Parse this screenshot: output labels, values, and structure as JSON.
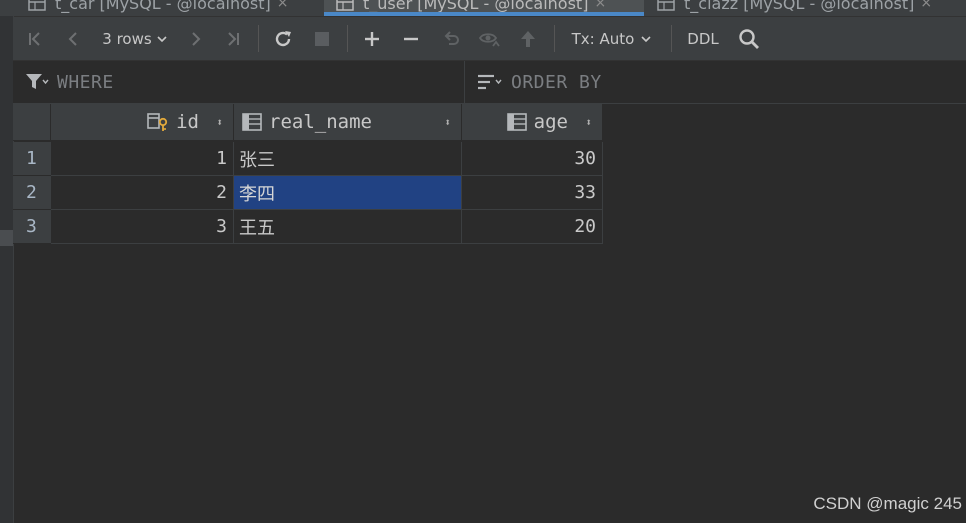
{
  "tabs": [
    {
      "label": "t_car [MySQL - @localhost]",
      "close": "×"
    },
    {
      "label": "t_user [MySQL - @localhost]",
      "close": "×"
    },
    {
      "label": "t_clazz [MySQL - @localhost]",
      "close": "×"
    }
  ],
  "toolbar": {
    "rows_label": "3 rows",
    "tx_label": "Tx: Auto",
    "ddl_label": "DDL"
  },
  "filter": {
    "where_label": "WHERE",
    "order_label": "ORDER BY"
  },
  "grid": {
    "columns": [
      {
        "name": "id",
        "sort": "⬍"
      },
      {
        "name": "real_name",
        "sort": "⬍"
      },
      {
        "name": "age",
        "sort": "⬍"
      }
    ],
    "rows": [
      {
        "num": "1",
        "id": "1",
        "real_name": "张三",
        "age": "30"
      },
      {
        "num": "2",
        "id": "2",
        "real_name": "李四",
        "age": "33"
      },
      {
        "num": "3",
        "id": "3",
        "real_name": "王五",
        "age": "20"
      }
    ],
    "selected": {
      "row": 2,
      "column": "real_name"
    }
  },
  "watermark": "CSDN @magic 245",
  "colors": {
    "accent": "#4a88c7",
    "selection": "#214283",
    "background": "#2b2b2b"
  }
}
